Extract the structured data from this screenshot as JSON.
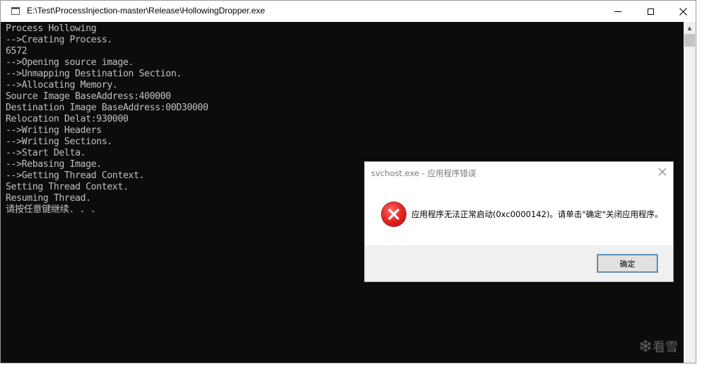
{
  "window": {
    "title": "E:\\Test\\ProcessInjection-master\\Release\\HollowingDropper.exe"
  },
  "console": {
    "lines": [
      "Process Hollowing",
      "-->Creating Process.",
      "6572",
      "-->Opening source image.",
      "-->Unmapping Destination Section.",
      "-->Allocating Memory.",
      "Source Image BaseAddress:400000",
      "Destination Image BaseAddress:00D30000",
      "Relocation Delat:930000",
      "-->Writing Headers",
      "-->Writing Sections.",
      "-->Start Delta.",
      "-->Rebasing Image.",
      "-->Getting Thread Context.",
      "Setting Thread Context.",
      "Resuming Thread.",
      "请按任意键继续. . ."
    ]
  },
  "dialog": {
    "title": "svchost.exe - 应用程序错误",
    "message": "应用程序无法正常启动(0xc0000142)。请单击\"确定\"关闭应用程序。",
    "ok_label": "确定",
    "icon": "error-icon"
  },
  "watermark": {
    "text": "看雪"
  },
  "colors": {
    "console_bg": "#0c0c0c",
    "console_fg": "#c0c0c0",
    "dialog_accent": "#0078d7",
    "error_red": "#e0201c"
  }
}
